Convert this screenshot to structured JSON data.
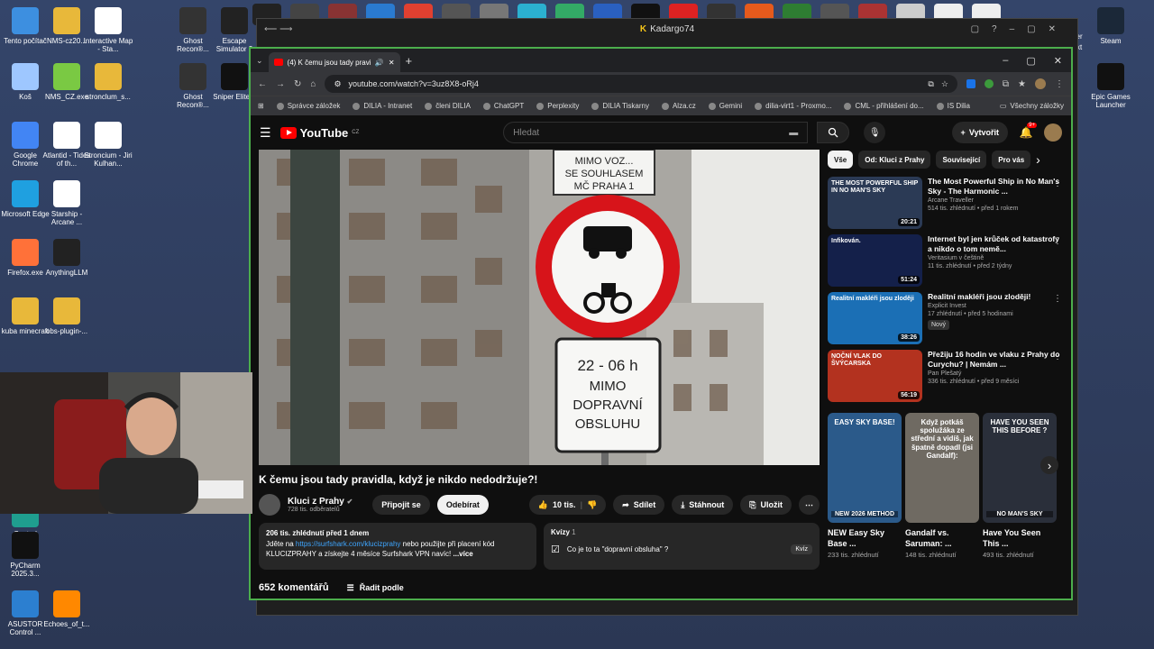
{
  "desktop": {
    "icons": [
      {
        "label": "Tento počítač",
        "color": "#3d8fe0"
      },
      {
        "label": "NMS-cz20...",
        "color": "#e8b83a"
      },
      {
        "label": "Interactive Map - Sta...",
        "color": "#ffffff"
      },
      {
        "label": "Ghost Recon®...",
        "color": "#333333"
      },
      {
        "label": "Escape Simulator 2",
        "color": "#222222"
      },
      {
        "label": "Koš",
        "color": "#9ec7ff"
      },
      {
        "label": "NMS_CZ.exe",
        "color": "#7ac943"
      },
      {
        "label": "stronclum_s...",
        "color": "#e8b83a"
      },
      {
        "label": "Ghost Recon®...",
        "color": "#333333"
      },
      {
        "label": "Sniper Elite 5",
        "color": "#111111"
      },
      {
        "label": "Google Chrome",
        "color": "#4285f4"
      },
      {
        "label": "Atlantid - Tides of th...",
        "color": "#ffffff"
      },
      {
        "label": "Stroncium - Jiri Kulhan...",
        "color": "#ffffff"
      },
      {
        "label": "Microsoft Edge",
        "color": "#1fa0e0"
      },
      {
        "label": "Starship - Arcane ...",
        "color": "#ffffff"
      },
      {
        "label": "Firefox.exe",
        "color": "#ff7139"
      },
      {
        "label": "AnythingLLM",
        "color": "#222222"
      },
      {
        "label": "kuba minecraft",
        "color": "#e8b83a"
      },
      {
        "label": "obs-plugin-...",
        "color": "#e8b83a"
      },
      {
        "label": "Control",
        "color": "#1f9e8f"
      },
      {
        "label": "PyCharm 2025.3...",
        "color": "#111111"
      },
      {
        "label": "ASUSTOR Control ...",
        "color": "#2c7fd0"
      },
      {
        "label": "Echoes_of_t...",
        "color": "#ff8800"
      }
    ],
    "right_icons": [
      {
        "label": "Steam",
        "color": "#1b2838"
      },
      {
        "label": "Epic Games Launcher",
        "color": "#111111"
      },
      {
        "label": "ter",
        "color": "#555555"
      },
      {
        "label": "txt",
        "color": "#555555"
      }
    ]
  },
  "outer_window": {
    "title": "Kadargo74"
  },
  "browser": {
    "tab_title": "(4) K čemu jsou tady pravidl",
    "url": "youtube.com/watch?v=3uz8X8-oRj4",
    "bookmarks": [
      "Správce záložek",
      "DILIA - Intranet",
      "členi DILIA",
      "ChatGPT",
      "Perplexity",
      "DILIA Tiskarny",
      "Alza.cz",
      "Gemini",
      "dilia-virt1 - Proxmo...",
      "CML - přihlášení do...",
      "IS Dilia"
    ],
    "bookmarks_all": "Všechny záložky"
  },
  "youtube": {
    "logo": "YouTube",
    "region": "CZ",
    "search_placeholder": "Hledat",
    "create_label": "Vytvořit",
    "notifications": "9+",
    "video": {
      "title": "K čemu jsou tady pravidla, když je nikdo nedodržuje?!",
      "sign_top": "MIMO VOZ... SE SOUHLASEM MČ PRAHA 1",
      "sign_line1": "22 - 06 h",
      "sign_line2": "MIMO",
      "sign_line3": "DOPRAVNÍ",
      "sign_line4": "OBSLUHU"
    },
    "channel": {
      "name": "Kluci z Prahy",
      "subs": "728 tis. odběratelů",
      "join": "Připojit se",
      "subscribe": "Odebírat"
    },
    "actions": {
      "likes": "10 tis.",
      "share": "Sdílet",
      "download": "Stáhnout",
      "save": "Uložit"
    },
    "description": {
      "stats": "206 tis. zhlédnutí  před 1 dnem",
      "line1_a": "Jděte na ",
      "line1_link": "https://surfshark.com/klucizprahy",
      "line1_b": " nebo použijte při placení kód",
      "line2": "KLUCIZPRAHY a získejte 4 měsíce Surfshark VPN navíc!",
      "more": "...více"
    },
    "quiz": {
      "header": "Kvízy",
      "count": "1",
      "question": "Co je to ta \"dopravní obsluha\" ?",
      "badge": "Kvíz"
    },
    "comments": {
      "count": "652 komentářů",
      "sort": "Řadit podle"
    },
    "chips": [
      "Vše",
      "Od: Kluci z Prahy",
      "Související",
      "Pro vás"
    ],
    "recommendations": [
      {
        "title": "The Most Powerful Ship in No Man's Sky - The Harmonic ...",
        "channel": "Arcane Traveller",
        "meta": "514 tis. zhlédnutí • před 1 rokem",
        "duration": "20:21",
        "color": "#2b3a55",
        "thumb_text": "THE MOST POWERFUL SHIP IN NO MAN'S SKY",
        "badge": ""
      },
      {
        "title": "Internet byl jen krůček od katastrofy a nikdo o tom nemě...",
        "channel": "Veritasium v češtině",
        "meta": "11 tis. zhlédnutí • před 2 týdny",
        "duration": "51:24",
        "color": "#14204a",
        "thumb_text": "Infikován.",
        "badge": ""
      },
      {
        "title": "Realitní makléři jsou zloději!",
        "channel": "Explicit Invest",
        "meta": "17 zhlédnutí • před 5 hodinami",
        "duration": "38:26",
        "color": "#1b6fb5",
        "thumb_text": "Realitní makléři jsou zloději",
        "badge": "Nový"
      },
      {
        "title": "Přežiju 16 hodin ve vlaku z Prahy do Curychu? | Nemám ...",
        "channel": "Pan Plešatý",
        "meta": "336 tis. zhlédnutí • před 9 měsíci",
        "duration": "56:19",
        "color": "#b3321f",
        "thumb_text": "NOČNÍ VLAK DO ŠVÝCARSKA",
        "badge": ""
      }
    ],
    "shorts": [
      {
        "title": "NEW Easy Sky Base ...",
        "views": "233 tis. zhlédnutí",
        "color": "#2b5a8a",
        "thumb_text": "EASY SKY BASE!",
        "thumb_sub": "NEW 2026 METHOD"
      },
      {
        "title": "Gandalf vs. Saruman: ...",
        "views": "148 tis. zhlédnutí",
        "color": "#6f6a62",
        "thumb_text": "Když potkáš spolužáka ze střední a vidíš, jak špatně dopadl (jsi Gandalf):",
        "thumb_sub": ""
      },
      {
        "title": "Have You Seen This ...",
        "views": "493 tis. zhlédnutí",
        "color": "#2a2f3a",
        "thumb_text": "HAVE YOU SEEN THIS BEFORE ?",
        "thumb_sub": "NO MAN'S SKY"
      }
    ]
  }
}
